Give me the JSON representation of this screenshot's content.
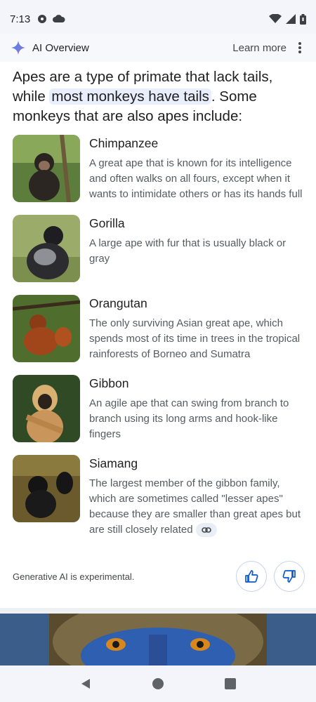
{
  "status_bar": {
    "time": "7:13"
  },
  "header": {
    "title": "AI Overview",
    "learn_more": "Learn more",
    "menu_icon": "more-vert-icon",
    "logo_icon": "sparkle-icon"
  },
  "intro": {
    "part1": "Apes are a type of primate that lack tails, while ",
    "highlight": "most monkeys have tails",
    "part2": ". Some monkeys that are also apes include:"
  },
  "items": [
    {
      "title": "Chimpanzee",
      "description": "A great ape that is known for its intelligence and often walks on all fours, except when it wants to intimidate others or has its hands full"
    },
    {
      "title": "Gorilla",
      "description": "A large ape with fur that is usually black or gray"
    },
    {
      "title": "Orangutan",
      "description": "The only surviving Asian great ape, which spends most of its time in trees in the tropical rainforests of Borneo and Sumatra"
    },
    {
      "title": "Gibbon",
      "description": "An agile ape that can swing from branch to branch using its long arms and hook-like fingers"
    },
    {
      "title": "Siamang",
      "description": "The largest member of the gibbon family, which are sometimes called \"lesser apes\" because they are smaller than great apes but are still closely related"
    }
  ],
  "footer": {
    "disclaimer": "Generative AI is experimental."
  },
  "colors": {
    "accent": "#1a73e8",
    "highlight_bg": "#e8eefb",
    "secondary_text": "#575b60"
  }
}
